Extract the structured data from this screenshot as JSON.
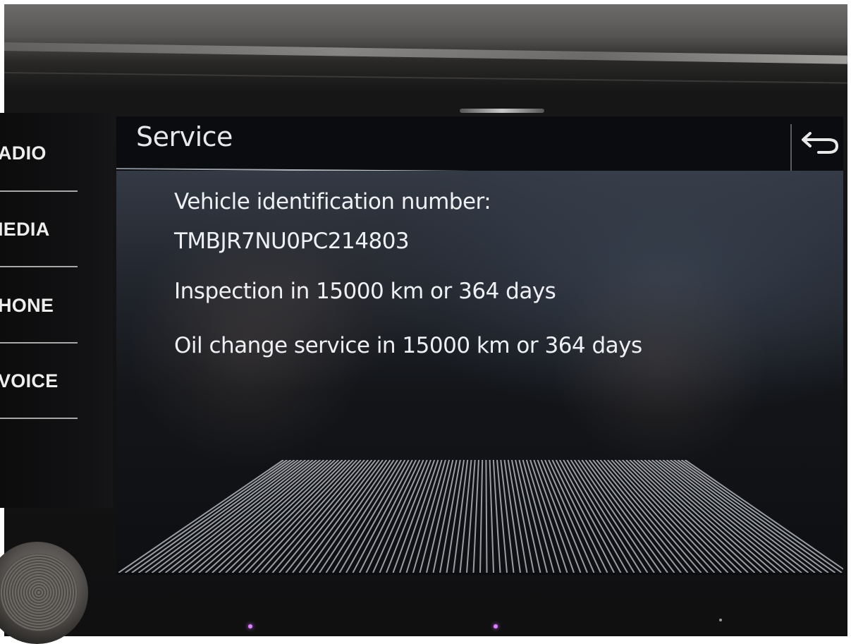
{
  "side_menu": {
    "items": [
      {
        "label": "ADIO"
      },
      {
        "label": "IEDIA"
      },
      {
        "label": "HONE"
      },
      {
        "label": "VOICE"
      }
    ]
  },
  "header": {
    "title": "Service",
    "back_icon": "back-arrow-icon"
  },
  "service_info": {
    "vin_label": "Vehicle identification number:",
    "vin_value": "TMBJR7NU0PC214803",
    "inspection": "Inspection in 15000 km or 364 days",
    "oil_change": "Oil change service in 15000 km or 364 days"
  }
}
